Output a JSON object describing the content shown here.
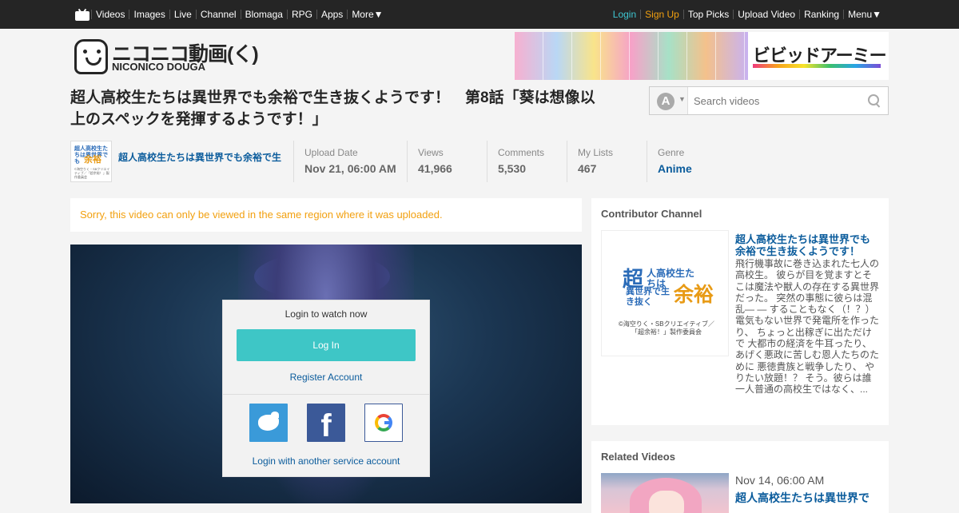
{
  "topbar": {
    "left_items": [
      "Videos",
      "Images",
      "Live",
      "Channel",
      "Blomaga",
      "RPG",
      "Apps",
      "More▼"
    ],
    "login": "Login",
    "signup": "Sign Up",
    "right_items": [
      "Top Picks",
      "Upload Video",
      "Ranking",
      "Menu▼"
    ]
  },
  "logo": {
    "jp": "ニコニコ動画(く)",
    "en": "NICONICO DOUGA"
  },
  "banner": {
    "title": "ビビッドアーミー"
  },
  "video": {
    "title": "超人高校生たちは異世界でも余裕で生き抜くようです！　第8話「葵は想像以上のスペックを発揮するようです！」",
    "channel_name": "超人高校生たちは異世界でも余裕で生き抜くようです！",
    "thumb_text": {
      "small": "超人高校生たちは異世界でも",
      "big": "余裕",
      "credit": "©海空りく・SBクリエイティブ／「超余裕！」製作委員会"
    },
    "stats": [
      {
        "label": "Upload Date",
        "value": "Nov 21, 06:00 AM"
      },
      {
        "label": "Views",
        "value": "41,966"
      },
      {
        "label": "Comments",
        "value": "5,530"
      },
      {
        "label": "My Lists",
        "value": "467"
      },
      {
        "label": "Genre",
        "value": "Anime"
      }
    ]
  },
  "search": {
    "selector_letter": "A",
    "placeholder": "Search videos"
  },
  "notice": "Sorry, this video can only be viewed in the same region where it was uploaded.",
  "login_box": {
    "heading": "Login to watch now",
    "login_button": "Log In",
    "register": "Register Account",
    "sns": [
      "twitter",
      "facebook",
      "google"
    ],
    "other": "Login with another service account"
  },
  "contributor": {
    "heading": "Contributor Channel",
    "thumb": {
      "big1": "超",
      "side": "人高校生たちは",
      "big2": "余裕",
      "side2": "異世界で生き抜く",
      "credit": "©海空りく・SBクリエイティブ／「超余裕！」製作委員会"
    },
    "title": "超人高校生たちは異世界でも余裕で生き抜くようです！",
    "description": "飛行機事故に巻き込まれた七人の高校生。 彼らが目を覚ますとそこは魔法や獣人の存在する異世界だった。 突然の事態に彼らは混乱― ― することもなく（！？） 電気もない世界で発電所を作ったり、 ちょっと出稼ぎに出ただけで 大都市の経済を牛耳ったり、 あげく悪政に苦しむ恩人たちのために 悪徳貴族と戦争したり、 やりたい放題！？ そう。彼らは誰一人普通の高校生ではなく、..."
  },
  "related": {
    "heading": "Related Videos",
    "items": [
      {
        "date": "Nov 14, 06:00 AM",
        "title": "超人高校生たちは異世界で"
      }
    ]
  },
  "colors": {
    "topbar": "#252525",
    "login_link": "#3ec6d1",
    "signup_link": "#f2a00f",
    "link_blue": "#0b5c9c",
    "login_button": "#3ec6c6",
    "notice": "#f2a00f"
  }
}
